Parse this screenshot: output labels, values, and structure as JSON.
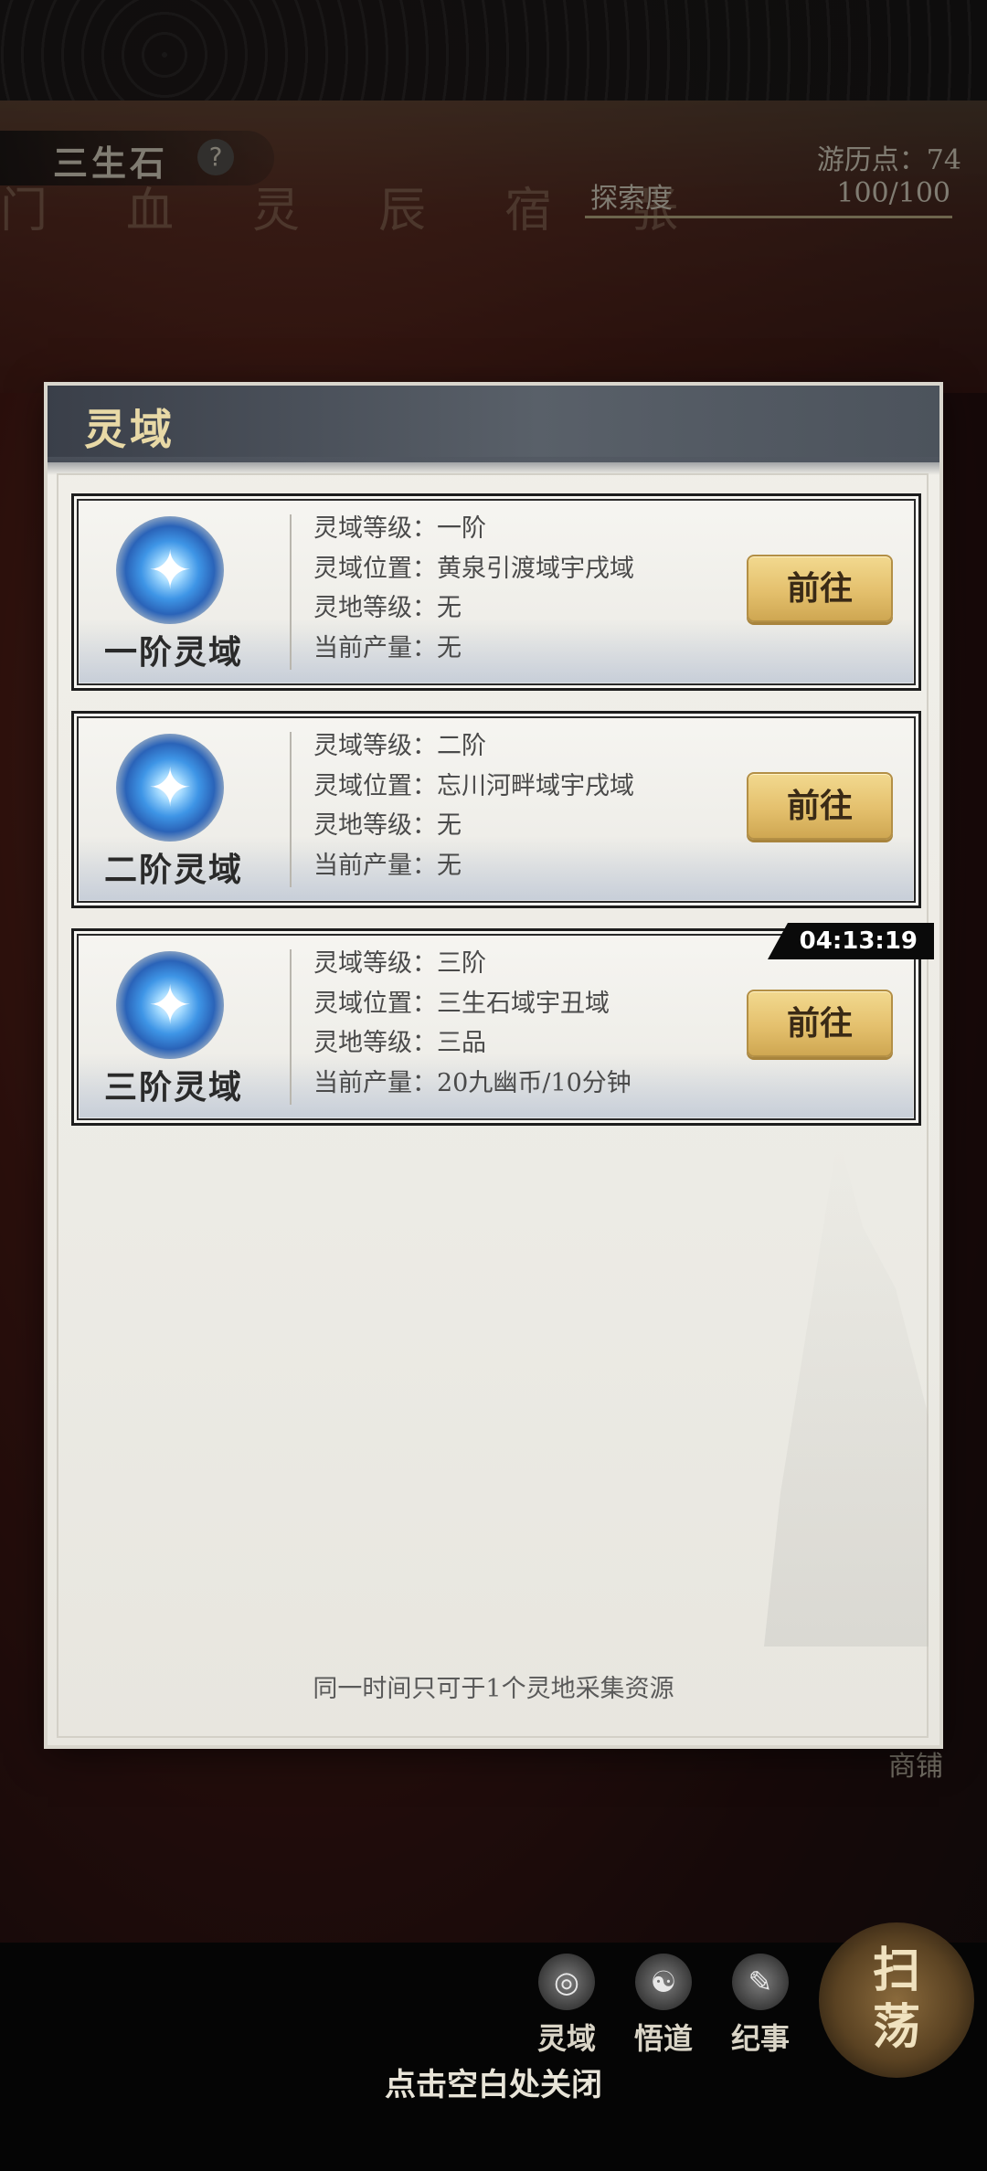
{
  "hud": {
    "stone_label": "三生石",
    "help_glyph": "?",
    "constellation": "门血灵辰宿张",
    "travel_points": "游历点：74",
    "explore_label": "探索度",
    "explore_value": "100/100",
    "shop_label": "商铺"
  },
  "dialog": {
    "title": "灵域",
    "cards": [
      {
        "name": "一阶灵域",
        "rows": [
          "灵域等级：一阶",
          "灵域位置：黄泉引渡域宇戌域",
          "灵地等级：无",
          "当前产量：无"
        ],
        "button": "前往"
      },
      {
        "name": "二阶灵域",
        "rows": [
          "灵域等级：二阶",
          "灵域位置：忘川河畔域宇戌域",
          "灵地等级：无",
          "当前产量：无"
        ],
        "button": "前往"
      },
      {
        "name": "三阶灵域",
        "rows": [
          "灵域等级：三阶",
          "灵域位置：三生石域宇丑域",
          "灵地等级：三品",
          "当前产量：20九幽币/10分钟"
        ],
        "button": "前往",
        "timer": "04:13:19"
      }
    ],
    "footer_note": "同一时间只可于1个灵地采集资源"
  },
  "bottom_nav": {
    "items": [
      {
        "label": "灵域",
        "icon": "spirit-domain-icon"
      },
      {
        "label": "悟道",
        "icon": "enlightenment-icon"
      },
      {
        "label": "纪事",
        "icon": "chronicle-book-icon"
      }
    ],
    "sweep": "扫荡"
  },
  "close_hint": "点击空白处关闭",
  "colors": {
    "header": "#4c535c",
    "title": "#e8d9a6",
    "button": "#e4c06d",
    "orb": "#3e95e6"
  }
}
